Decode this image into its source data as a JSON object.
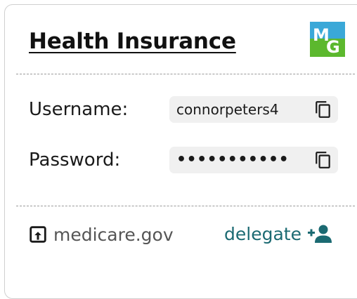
{
  "card": {
    "title": "Health Insurance",
    "logo": {
      "text": "MG",
      "colors": {
        "top": "#3aa8d8",
        "bottom": "#5cb82e",
        "letter": "#ffffff"
      }
    }
  },
  "credentials": {
    "username": {
      "label": "Username:",
      "value": "connorpeters4",
      "copy_icon": "copy-icon"
    },
    "password": {
      "label": "Password:",
      "value": "•••••••••••",
      "copy_icon": "copy-icon"
    }
  },
  "footer": {
    "site": {
      "icon": "open-in-new-icon",
      "text": "medicare.gov"
    },
    "delegate": {
      "text": "delegate",
      "icon": "add-person-icon",
      "color": "#1b6a72"
    }
  }
}
